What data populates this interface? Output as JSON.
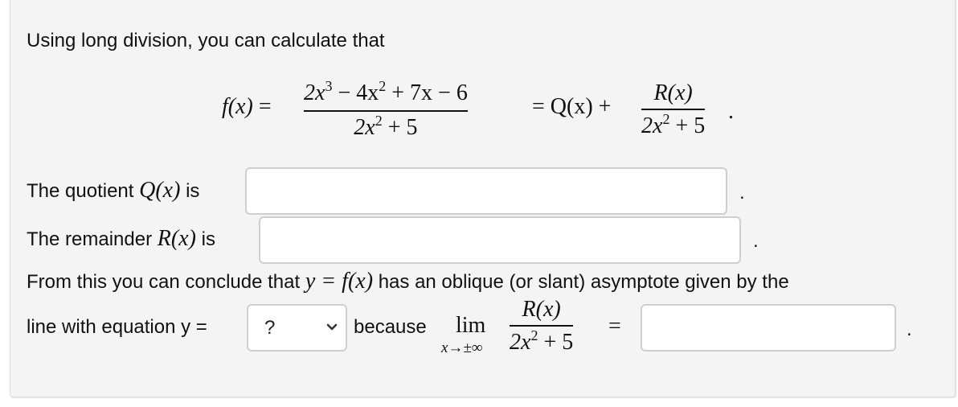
{
  "intro": "Using long division, you can calculate that",
  "equation": {
    "lhs": "f(x)",
    "equals": "=",
    "numerator": {
      "t1": "2x",
      "e1": "3",
      "t2": " − 4x",
      "e2": "2",
      "t3": " + 7x − 6"
    },
    "denominator": {
      "t1": "2x",
      "e1": "2",
      "t2": " + 5"
    },
    "rhs_q": "= Q(x) +",
    "rhs_num": "R(x)",
    "rhs_den": {
      "t1": "2x",
      "e1": "2",
      "t2": " + 5"
    },
    "end": "."
  },
  "quotient": {
    "label_pre": "The quotient",
    "label_var": "Q(x)",
    "label_post": "is",
    "value": "",
    "placeholder": "",
    "end": "."
  },
  "remainder": {
    "label_pre": "The remainder",
    "label_var": "R(x)",
    "label_post": "is",
    "value": "",
    "placeholder": "",
    "end": "."
  },
  "conclusion": {
    "pre": "From this you can conclude that",
    "math": "y = f(x)",
    "post": "has an oblique (or slant) asymptote given by the"
  },
  "line_eq": {
    "label": "line with equation y =",
    "select_value": "?",
    "because": "because",
    "lim": "lim",
    "lim_sub": "x→±∞",
    "num": "R(x)",
    "den": {
      "t1": "2x",
      "e1": "2",
      "t2": " + 5"
    },
    "equals": "=",
    "answer_value": "",
    "end": "."
  }
}
